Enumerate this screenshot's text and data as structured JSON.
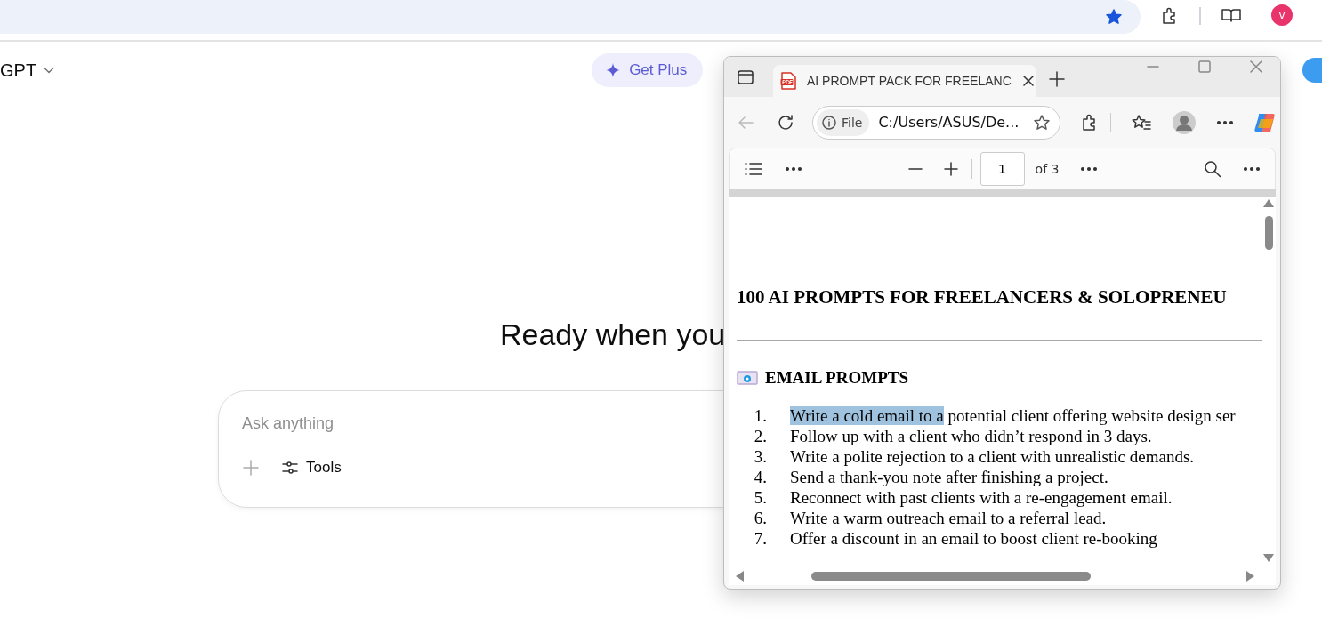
{
  "browser": {
    "bookmarked": true,
    "profile_initial": "v"
  },
  "app": {
    "model_label": "GPT",
    "upgrade_button": "Get Plus",
    "headline": "Ready when you",
    "composer": {
      "placeholder": "Ask anything",
      "tools_label": "Tools"
    }
  },
  "pdf_window": {
    "tab_title": "AI PROMPT PACK FOR FREELANC",
    "address_scheme": "File",
    "address": "C:/Users/ASUS/De...",
    "page_number": "1",
    "page_total": "of 3",
    "document": {
      "title": "100 AI PROMPTS FOR FREELANCERS & SOLOPRENEU",
      "sections": [
        {
          "heading": "EMAIL PROMPTS",
          "items": [
            {
              "number": "1.",
              "selected_text": "Write a cold email to a",
              "text": " potential client offering website design ser"
            },
            {
              "number": "2.",
              "text": "Follow up with a client who didn’t respond in 3 days."
            },
            {
              "number": "3.",
              "text": "Write a polite rejection to a client with unrealistic demands."
            },
            {
              "number": "4.",
              "text": "Send a thank-you note after finishing a project."
            },
            {
              "number": "5.",
              "text": "Reconnect with past clients with a re-engagement email."
            },
            {
              "number": "6.",
              "text": "Write a warm outreach email to a referral lead."
            },
            {
              "number": "7.",
              "text": "Offer a discount in an email to boost client re-booking"
            }
          ]
        }
      ]
    }
  }
}
